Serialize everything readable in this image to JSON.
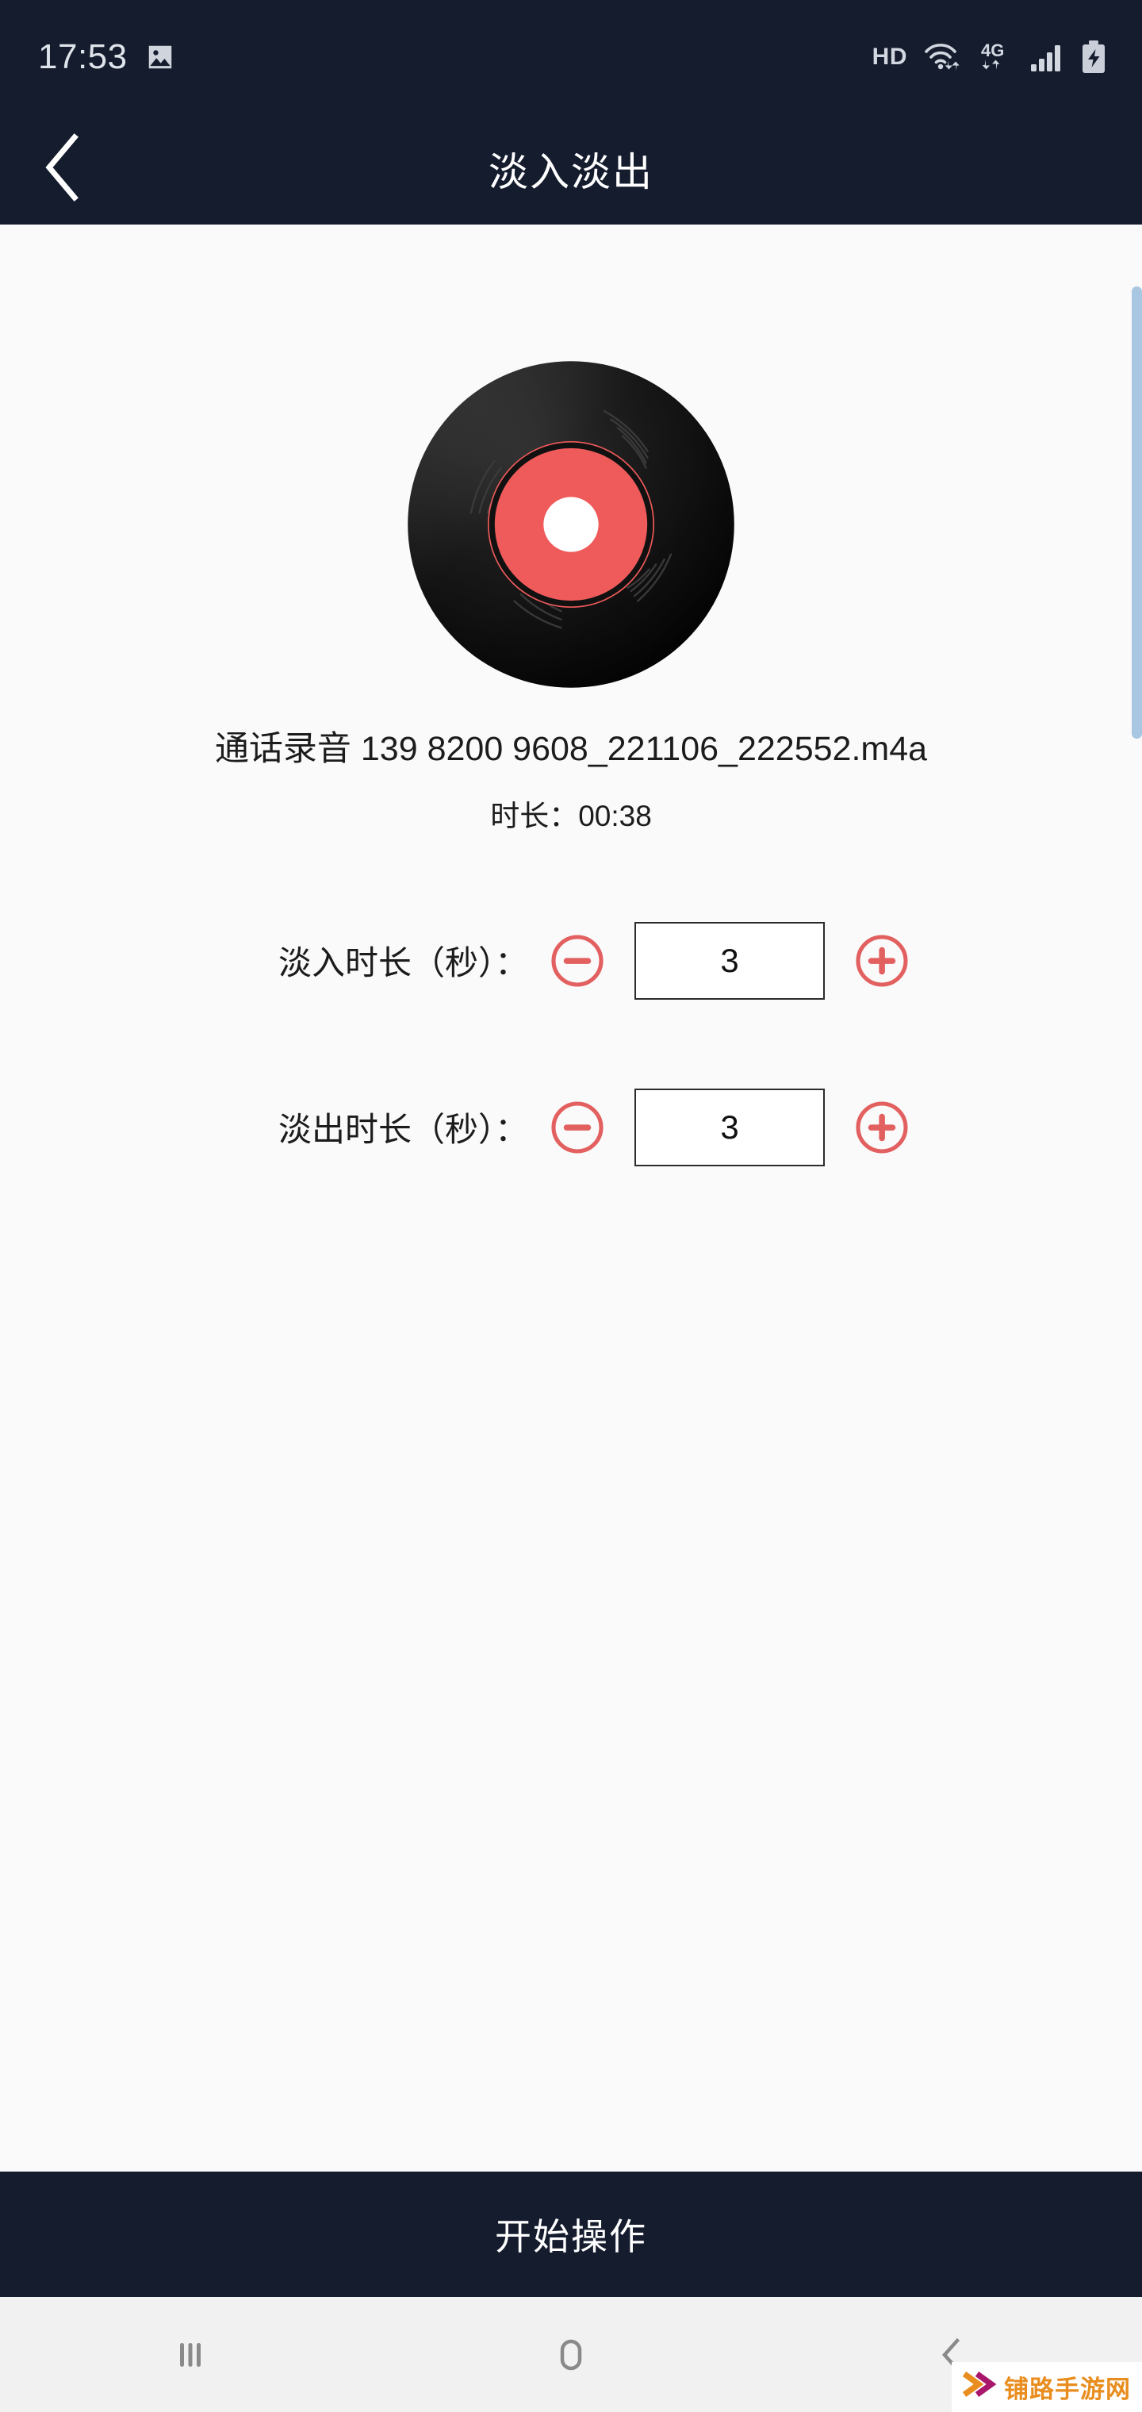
{
  "status_bar": {
    "time": "17:53",
    "left_icons": [
      {
        "name": "screenshot-image-icon",
        "glyph": "image"
      }
    ],
    "right_icons": [
      {
        "name": "hd-label",
        "label": "HD"
      },
      {
        "name": "wifi-icon",
        "glyph": "wifi-data"
      },
      {
        "name": "network-4g-icon",
        "label": "4G"
      },
      {
        "name": "signal-bars-icon",
        "glyph": "signal"
      },
      {
        "name": "battery-charging-icon",
        "glyph": "battery-charging"
      }
    ],
    "network_label": "4G",
    "hd_label": "HD"
  },
  "header": {
    "title": "淡入淡出",
    "back_icon": "chevron-left-icon"
  },
  "media": {
    "artwork_icon": "vinyl-record-icon",
    "file_name": "通话录音 139 8200 9608_221106_222552.m4a",
    "duration_line": "时长：00:38",
    "duration_label": "时长",
    "duration_value": "00:38"
  },
  "settings": {
    "rows": [
      {
        "id": "fade-in",
        "label": "淡入时长（秒）：",
        "value": "3",
        "decrement_icon": "minus-circle-icon",
        "increment_icon": "plus-circle-icon"
      },
      {
        "id": "fade-out",
        "label": "淡出时长（秒）：",
        "value": "3",
        "decrement_icon": "minus-circle-icon",
        "increment_icon": "plus-circle-icon"
      }
    ]
  },
  "action": {
    "label": "开始操作"
  },
  "nav_bar": {
    "recents_icon": "recents-icon",
    "home_icon": "home-icon",
    "back_icon": "back-chevron-icon"
  },
  "watermark": {
    "text": "铺路手游网",
    "icon": "double-chevron-icon"
  },
  "colors": {
    "header_bg": "#141c2e",
    "content_bg": "#fafafa",
    "accent_red": "#e2605f",
    "disc_label": "#ef5a5a",
    "scrollbar": "#a9c6e2",
    "nav_bg": "#f1f1f1",
    "watermark_orange": "#e88d1e",
    "watermark_magenta": "#a8176b"
  }
}
